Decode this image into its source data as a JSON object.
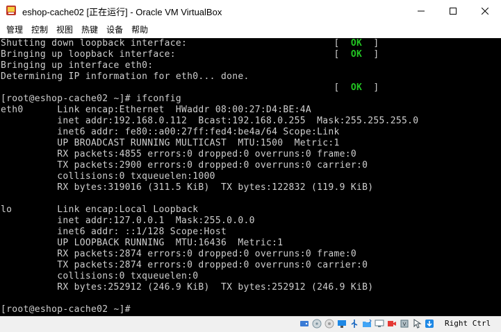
{
  "window": {
    "title": "eshop-cache02 [正在运行] - Oracle VM VirtualBox"
  },
  "menu": {
    "items": [
      "管理",
      "控制",
      "视图",
      "热键",
      "设备",
      "帮助"
    ]
  },
  "console": {
    "ok_label": "OK",
    "lines": [
      {
        "text": "Shutting down loopback interface:",
        "ok": true
      },
      {
        "text": "Bringing up loopback interface:",
        "ok": true
      },
      {
        "text": "Bringing up interface eth0:",
        "ok": false
      },
      {
        "text": "Determining IP information for eth0... done.",
        "ok": false
      },
      {
        "text": "",
        "ok": true
      },
      {
        "text": "[root@eshop-cache02 ~]# ifconfig",
        "ok": false
      },
      {
        "text": "eth0      Link encap:Ethernet  HWaddr 08:00:27:D4:BE:4A",
        "ok": false
      },
      {
        "text": "          inet addr:192.168.0.112  Bcast:192.168.0.255  Mask:255.255.255.0",
        "ok": false
      },
      {
        "text": "          inet6 addr: fe80::a00:27ff:fed4:be4a/64 Scope:Link",
        "ok": false
      },
      {
        "text": "          UP BROADCAST RUNNING MULTICAST  MTU:1500  Metric:1",
        "ok": false
      },
      {
        "text": "          RX packets:4855 errors:0 dropped:0 overruns:0 frame:0",
        "ok": false
      },
      {
        "text": "          TX packets:2900 errors:0 dropped:0 overruns:0 carrier:0",
        "ok": false
      },
      {
        "text": "          collisions:0 txqueuelen:1000",
        "ok": false
      },
      {
        "text": "          RX bytes:319016 (311.5 KiB)  TX bytes:122832 (119.9 KiB)",
        "ok": false
      },
      {
        "text": "",
        "ok": false
      },
      {
        "text": "lo        Link encap:Local Loopback",
        "ok": false
      },
      {
        "text": "          inet addr:127.0.0.1  Mask:255.0.0.0",
        "ok": false
      },
      {
        "text": "          inet6 addr: ::1/128 Scope:Host",
        "ok": false
      },
      {
        "text": "          UP LOOPBACK RUNNING  MTU:16436  Metric:1",
        "ok": false
      },
      {
        "text": "          RX packets:2874 errors:0 dropped:0 overruns:0 frame:0",
        "ok": false
      },
      {
        "text": "          TX packets:2874 errors:0 dropped:0 overruns:0 carrier:0",
        "ok": false
      },
      {
        "text": "          collisions:0 txqueuelen:0",
        "ok": false
      },
      {
        "text": "          RX bytes:252912 (246.9 KiB)  TX bytes:252912 (246.9 KiB)",
        "ok": false
      },
      {
        "text": "",
        "ok": false
      },
      {
        "text": "[root@eshop-cache02 ~]#",
        "ok": false
      }
    ]
  },
  "statusbar": {
    "icons": [
      "hard-disk-icon",
      "optical-drive-icon",
      "audio-icon",
      "network-icon",
      "usb-icon",
      "shared-folder-icon",
      "display-icon",
      "video-capture-icon",
      "cpu-icon",
      "mouse-integration-icon",
      "keyboard-icon"
    ],
    "host_key": "Right Ctrl"
  },
  "colors": {
    "console_bg": "#000000",
    "console_fg": "#cfcfcf",
    "ok_green": "#22c322"
  }
}
